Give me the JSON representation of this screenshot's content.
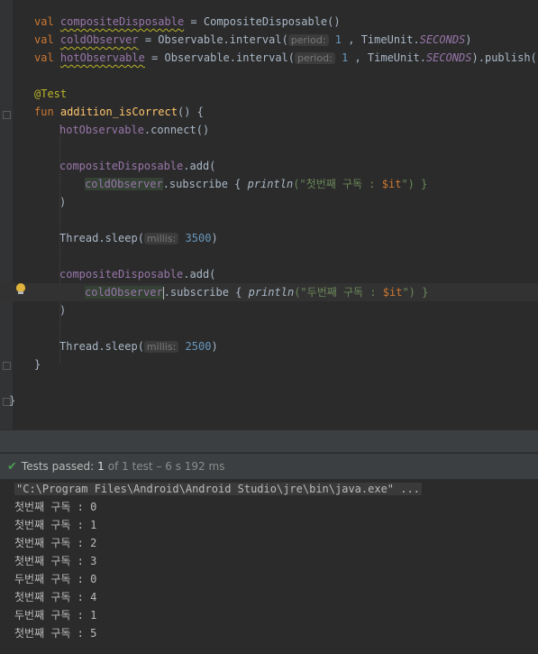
{
  "editor": {
    "lines": [
      {
        "k1": "val",
        "v": "compositeDisposable",
        "rest": " = CompositeDisposable()"
      },
      {
        "k1": "val",
        "v": "coldObserver",
        "rest1": " = Observable.interval(",
        "hint": "period:",
        "num": "1",
        "rest2": " , TimeUnit.",
        "sec": "SECONDS",
        "rest3": ")"
      },
      {
        "k1": "val",
        "v": "hotObservable",
        "rest1": " = Observable.interval(",
        "hint": "period:",
        "num": "1",
        "rest2": " , TimeUnit.",
        "sec": "SECONDS",
        "rest3": ").publish()"
      },
      {
        "ann": "@Test"
      },
      {
        "k1": "fun",
        "fn": "addition_isCorrect",
        "rest": "() {"
      },
      {
        "v": "hotObservable",
        "rest": ".connect()"
      },
      {
        "v": "compositeDisposable",
        "rest": ".add("
      },
      {
        "v": "coldObserver",
        "rest1": ".subscribe { ",
        "it1": "println",
        "str1": "(\"첫번째 구독 : ",
        "sv": "$it",
        "str2": "\") }"
      },
      {
        "rest": ")"
      },
      {
        "rest1": "Thread.sleep(",
        "hint": "millis:",
        "num": "3500",
        "rest2": ")"
      },
      {
        "v": "compositeDisposable",
        "rest": ".add("
      },
      {
        "v": "coldObserver",
        "rest1": ".subscribe { ",
        "it1": "println",
        "str1": "(\"두번째 구독 : ",
        "sv": "$it",
        "str2": "\") }"
      },
      {
        "rest": ")"
      },
      {
        "rest1": "Thread.sleep(",
        "hint": "millis:",
        "num": "2500",
        "rest2": ")"
      },
      {
        "rest": "}"
      },
      {
        "rest": "}"
      }
    ]
  },
  "test_status": {
    "passed_label": "Tests passed:",
    "count": "1",
    "detail": "of 1 test – 6 s 192 ms"
  },
  "console": {
    "command": "\"C:\\Program Files\\Android\\Android Studio\\jre\\bin\\java.exe\" ...",
    "output": [
      "첫번째 구독 : 0",
      "첫번째 구독 : 1",
      "첫번째 구독 : 2",
      "첫번째 구독 : 3",
      "두번째 구독 : 0",
      "첫번째 구독 : 4",
      "두번째 구독 : 1",
      "첫번째 구독 : 5"
    ]
  },
  "colors": {
    "keyword": "#cc7832",
    "field": "#9876aa",
    "string": "#6a8759",
    "number": "#6897bb",
    "pass": "#499c54"
  },
  "icons": [
    "lightbulb-icon",
    "check-icon",
    "fold-marker-icon"
  ]
}
